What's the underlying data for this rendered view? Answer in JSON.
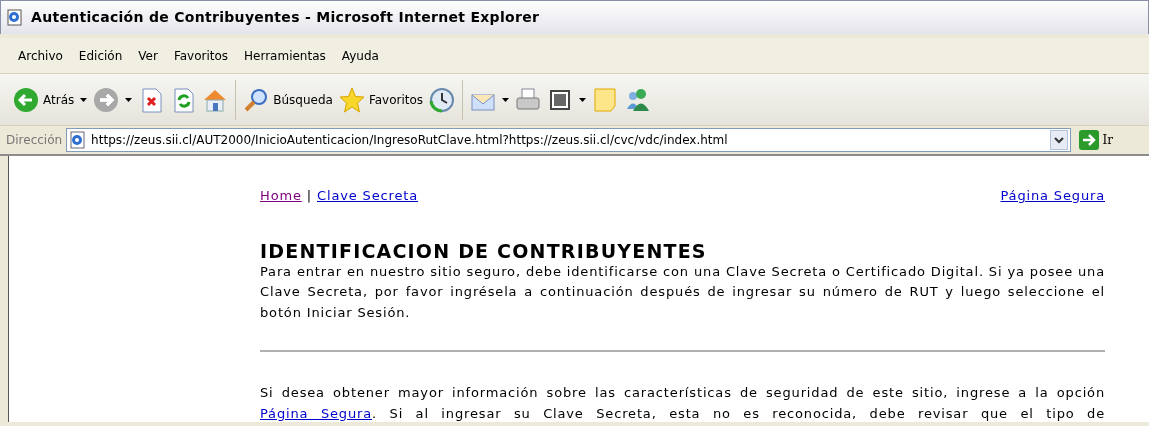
{
  "window": {
    "title": "Autenticación de Contribuyentes - Microsoft Internet Explorer"
  },
  "menu": [
    "Archivo",
    "Edición",
    "Ver",
    "Favoritos",
    "Herramientas",
    "Ayuda"
  ],
  "toolbar": [
    {
      "kind": "back",
      "label": "Atrás",
      "dropdown": true
    },
    {
      "kind": "forward",
      "dropdown": true,
      "disabled": true
    },
    {
      "kind": "stop"
    },
    {
      "kind": "refresh"
    },
    {
      "kind": "home"
    },
    {
      "kind": "separator"
    },
    {
      "kind": "search",
      "label": "Búsqueda"
    },
    {
      "kind": "favorites",
      "label": "Favoritos"
    },
    {
      "kind": "history"
    },
    {
      "kind": "separator"
    },
    {
      "kind": "mail",
      "dropdown": true
    },
    {
      "kind": "print"
    },
    {
      "kind": "edit",
      "dropdown": true
    },
    {
      "kind": "note"
    },
    {
      "kind": "messenger"
    }
  ],
  "address": {
    "label": "Dirección",
    "value": "https://zeus.sii.cl/AUT2000/InicioAutenticacion/IngresoRutClave.html?https://zeus.sii.cl/cvc/vdc/index.html",
    "go_label": "Ir"
  },
  "page": {
    "nav_links": [
      {
        "label": "Home",
        "visited": true
      },
      {
        "label": "Clave Secreta",
        "visited": false
      }
    ],
    "nav_separator": "|",
    "secure_link": {
      "label": "Página Segura",
      "visited": false
    },
    "heading": "IDENTIFICACION DE CONTRIBUYENTES",
    "intro": "Para entrar en nuestro sitio seguro, debe identificarse con una Clave Secreta o Certificado Digital. Si ya posee una Clave Secreta, por favor ingrésela a continuación después de ingresar su número de RUT y luego seleccione el botón Iniciar Sesión.",
    "info": [
      {
        "kind": "text",
        "text": "Si desea obtener mayor información sobre las características de seguridad de este sitio, ingrese a la opción "
      },
      {
        "kind": "link",
        "text": "Página Segura",
        "visited": false
      },
      {
        "kind": "text",
        "text": ". Si al ingresar su Clave Secreta, esta no es reconocida, debe revisar que el tipo de"
      }
    ]
  }
}
